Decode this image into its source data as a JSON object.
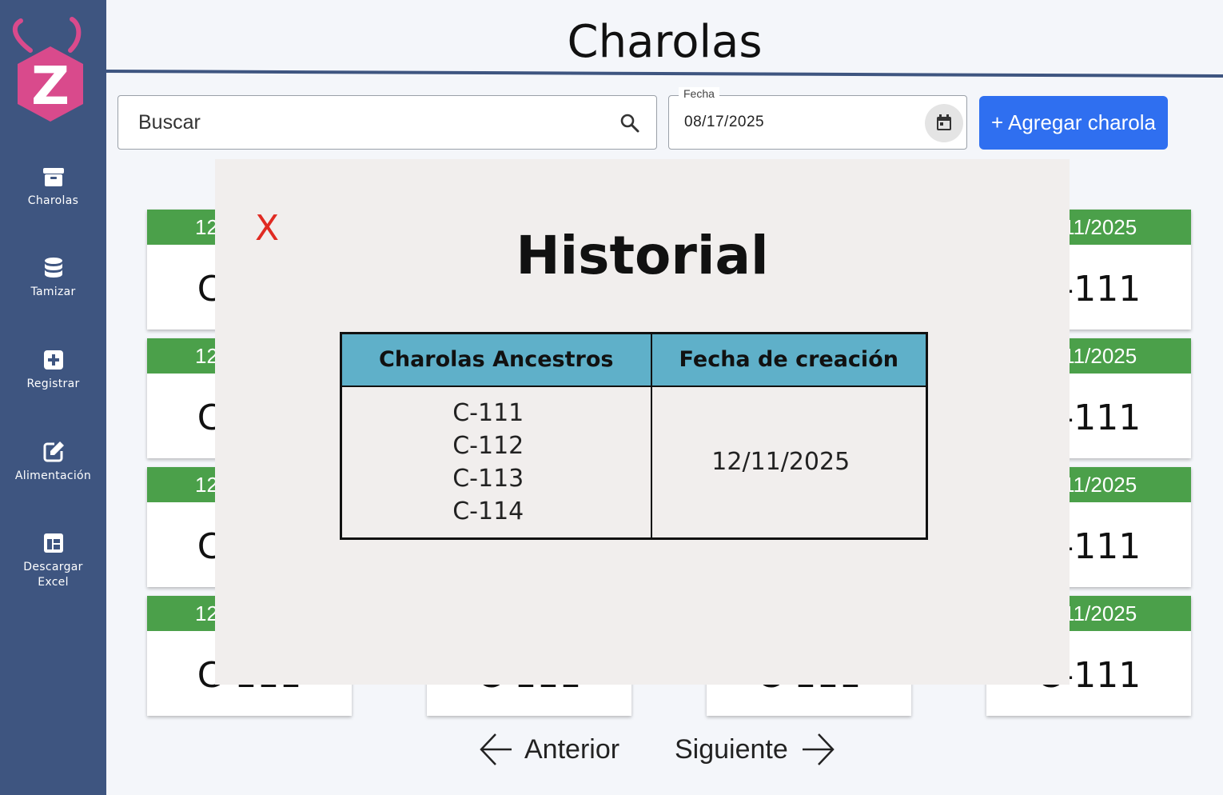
{
  "sidebar": {
    "logo_letter": "Z",
    "items": [
      {
        "label": "Charolas",
        "icon": "archive-box-icon"
      },
      {
        "label": "Tamizar",
        "icon": "database-icon"
      },
      {
        "label": "Registrar",
        "icon": "plus-square-icon"
      },
      {
        "label": "Alimentación",
        "icon": "edit-pencil-icon"
      },
      {
        "label": "Descargar Excel",
        "icon": "table-layout-icon"
      }
    ]
  },
  "header": {
    "title": "Charolas"
  },
  "toolbar": {
    "search_placeholder": "Buscar",
    "date_label": "Fecha",
    "date_value": "08/17/2025",
    "add_button": "+ Agregar charola"
  },
  "cards": [
    {
      "date": "12/11/2025",
      "code": "C-111"
    },
    {
      "date": "12/11/2025",
      "code": "C-111"
    },
    {
      "date": "12/11/2025",
      "code": "C-111"
    },
    {
      "date": "12/11/2025",
      "code": "C-111"
    }
  ],
  "pagination": {
    "prev": "Anterior",
    "next": "Siguiente"
  },
  "modal": {
    "close_label": "X",
    "title": "Historial",
    "table": {
      "headers": [
        "Charolas Ancestros",
        "Fecha de creación"
      ],
      "ancestors": [
        "C-111",
        "C-112",
        "C-113",
        "C-114"
      ],
      "created": "12/11/2025"
    }
  },
  "colors": {
    "sidebar": "#3e5580",
    "accent": "#2f6ff0",
    "card_header": "#4ba04a",
    "table_header": "#5fb0c9",
    "close": "#e02a22",
    "logo": "#d94a8c"
  }
}
